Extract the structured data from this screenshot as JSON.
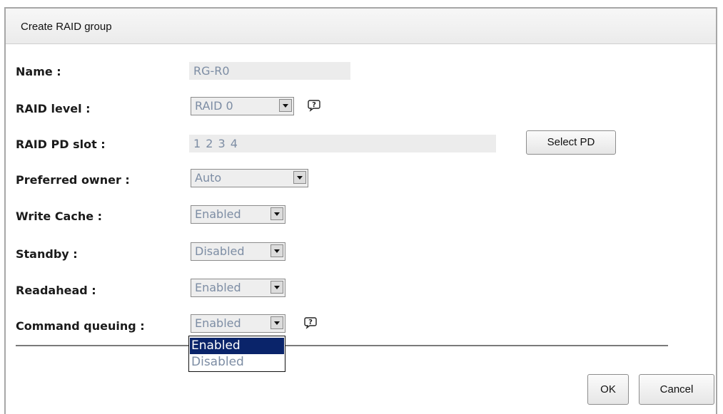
{
  "dialog": {
    "title": "Create RAID group"
  },
  "form": {
    "name": {
      "label": "Name :",
      "value": "RG-R0"
    },
    "raid_level": {
      "label": "RAID level :",
      "value": "RAID 0"
    },
    "raid_pd_slot": {
      "label": "RAID PD slot :",
      "value": "1 2 3 4",
      "button_label": "Select PD"
    },
    "preferred_owner": {
      "label": "Preferred owner :",
      "value": "Auto"
    },
    "write_cache": {
      "label": "Write Cache :",
      "value": "Enabled"
    },
    "standby": {
      "label": "Standby :",
      "value": "Disabled"
    },
    "readahead": {
      "label": "Readahead :",
      "value": "Enabled"
    },
    "command_queuing": {
      "label": "Command queuing :",
      "value": "Enabled",
      "options": [
        "Enabled",
        "Disabled"
      ],
      "highlighted_option": "Enabled"
    }
  },
  "footer": {
    "ok_label": "OK",
    "cancel_label": "Cancel"
  },
  "icons": {
    "help": "help-icon",
    "dropdown_arrow": "chevron-down-icon"
  },
  "colors": {
    "field_text": "#7d8da4",
    "field_background": "#ececec",
    "selection_highlight": "#0a246a",
    "label_text": "#1b1b1b"
  }
}
